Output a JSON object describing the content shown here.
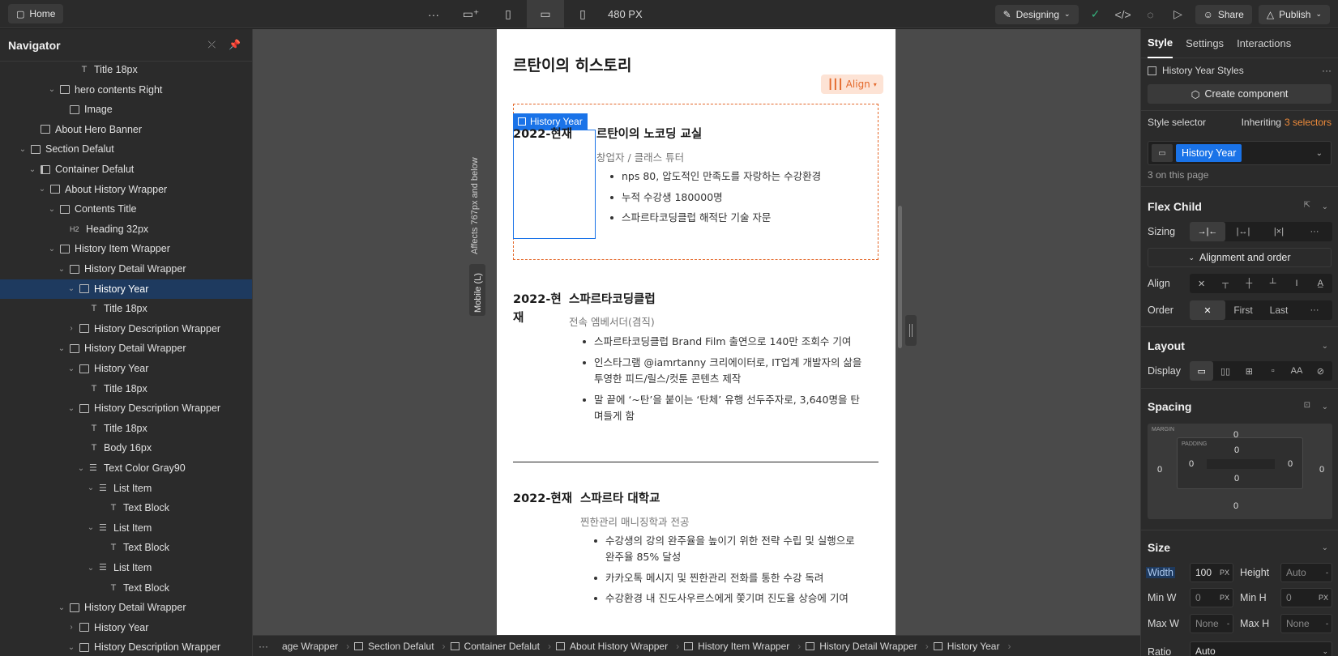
{
  "topbar": {
    "home_label": "Home",
    "width_label": "480 PX",
    "designing_label": "Designing",
    "share_label": "Share",
    "publish_label": "Publish"
  },
  "navigator": {
    "title": "Navigator",
    "items": [
      {
        "label": "Title 18px",
        "icon": "text",
        "depth": 6,
        "chev": ""
      },
      {
        "label": "hero contents Right",
        "icon": "box",
        "depth": 4,
        "chev": "v"
      },
      {
        "label": "Image",
        "icon": "image",
        "depth": 5,
        "chev": ""
      },
      {
        "label": "About Hero Banner",
        "icon": "box",
        "depth": 2,
        "chev": ""
      },
      {
        "label": "Section Defalut",
        "icon": "section",
        "depth": 1,
        "chev": "v"
      },
      {
        "label": "Container Defalut",
        "icon": "container",
        "depth": 2,
        "chev": "v"
      },
      {
        "label": "About History Wrapper",
        "icon": "box",
        "depth": 3,
        "chev": "v"
      },
      {
        "label": "Contents Title",
        "icon": "box",
        "depth": 4,
        "chev": "v"
      },
      {
        "label": "Heading 32px",
        "icon": "h2",
        "depth": 5,
        "chev": ""
      },
      {
        "label": "History Item Wrapper",
        "icon": "box",
        "depth": 4,
        "chev": "v"
      },
      {
        "label": "History Detail Wrapper",
        "icon": "box",
        "depth": 5,
        "chev": "v"
      },
      {
        "label": "History Year",
        "icon": "box",
        "depth": 6,
        "chev": "v",
        "selected": true
      },
      {
        "label": "Title 18px",
        "icon": "text",
        "depth": 7,
        "chev": ""
      },
      {
        "label": "History Description Wrapper",
        "icon": "box",
        "depth": 6,
        "chev": ">"
      },
      {
        "label": "History Detail Wrapper",
        "icon": "box",
        "depth": 5,
        "chev": "v"
      },
      {
        "label": "History Year",
        "icon": "box",
        "depth": 6,
        "chev": "v"
      },
      {
        "label": "Title 18px",
        "icon": "text",
        "depth": 7,
        "chev": ""
      },
      {
        "label": "History Description Wrapper",
        "icon": "box",
        "depth": 6,
        "chev": "v"
      },
      {
        "label": "Title 18px",
        "icon": "text",
        "depth": 7,
        "chev": ""
      },
      {
        "label": "Body 16px",
        "icon": "text",
        "depth": 7,
        "chev": ""
      },
      {
        "label": "Text Color Gray90",
        "icon": "list",
        "depth": 7,
        "chev": "v"
      },
      {
        "label": "List Item",
        "icon": "list",
        "depth": 8,
        "chev": "v"
      },
      {
        "label": "Text Block",
        "icon": "text",
        "depth": 9,
        "chev": ""
      },
      {
        "label": "List Item",
        "icon": "list",
        "depth": 8,
        "chev": "v"
      },
      {
        "label": "Text Block",
        "icon": "text",
        "depth": 9,
        "chev": ""
      },
      {
        "label": "List Item",
        "icon": "list",
        "depth": 8,
        "chev": "v"
      },
      {
        "label": "Text Block",
        "icon": "text",
        "depth": 9,
        "chev": ""
      },
      {
        "label": "History Detail Wrapper",
        "icon": "box",
        "depth": 5,
        "chev": "v"
      },
      {
        "label": "History Year",
        "icon": "box",
        "depth": 6,
        "chev": ">"
      },
      {
        "label": "History Description Wrapper",
        "icon": "box",
        "depth": 6,
        "chev": "v"
      }
    ]
  },
  "canvas": {
    "breakpoint_note": "Affects 767px and below",
    "breakpoint_tab": "Mobile (L)",
    "align_label": "Align",
    "selected_tag": "History Year",
    "heading": "르탄이의 히스토리",
    "entries": [
      {
        "year": "2022-현재",
        "title": "르탄이의 노코딩 교실",
        "role": "창업자 / 클래스 튜터",
        "bullets": [
          "nps 80, 압도적인 만족도를 자랑하는 수강환경",
          "누적 수강생 180000명",
          "스파르타코딩클럽 해적단 기술 자문"
        ]
      },
      {
        "year_line1": "2022-현",
        "year_line2": "재",
        "title": "스파르타코딩클럽",
        "role": "전속 엠베서더(겸직)",
        "bullets": [
          "스파르타코딩클럽 Brand Film 출연으로 140만 조회수 기여",
          "인스타그램 @iamrtanny 크리에이터로, IT업계 개발자의 삶을",
          "투영한 피드/릴스/컷툰 콘텐츠 제작",
          "말 끝에 ‘~탄’을 붙이는 ‘탄체’ 유행 선두주자로, 3,640명을 탄",
          "며들게 함"
        ]
      },
      {
        "year": "2022-현재",
        "title": "스파르타 대학교",
        "role": "찐한관리 매니징학과 전공",
        "bullets": [
          "수강생의 강의 완주율을 높이기 위한 전략 수립 및 실행으로",
          "완주율 85% 달성",
          "카카오톡 메시지 및 찐한관리 전화를 통한 수강 독려",
          "수강환경 내 진도사우르스에게 쫓기며 진도율 상승에 기여"
        ]
      }
    ]
  },
  "breadcrumb": [
    "age Wrapper",
    "Section Defalut",
    "Container Defalut",
    "About History Wrapper",
    "History Item Wrapper",
    "History Detail Wrapper",
    "History Year"
  ],
  "panel": {
    "tabs": [
      "Style",
      "Settings",
      "Interactions"
    ],
    "styles_label": "History Year Styles",
    "create_component": "Create component",
    "style_selector_label": "Style selector",
    "inheriting_label": "Inheriting",
    "inheriting_count": "3 selectors",
    "selector_chip": "History Year",
    "on_page": "3 on this page",
    "flex_child": "Flex Child",
    "sizing_label": "Sizing",
    "alignment_order": "Alignment and order",
    "align_label": "Align",
    "order_label": "Order",
    "order_first": "First",
    "order_last": "Last",
    "layout": "Layout",
    "display_label": "Display",
    "spacing": "Spacing",
    "margin_label": "MARGIN",
    "padding_label": "PADDING",
    "margin": {
      "top": "0",
      "right": "0",
      "bottom": "0",
      "left": "0"
    },
    "padding": {
      "top": "0",
      "right": "0",
      "bottom": "0",
      "left": "0"
    },
    "size": "Size",
    "width_label": "Width",
    "width_value": "100",
    "width_unit": "PX",
    "height_label": "Height",
    "height_value": "Auto",
    "minw_label": "Min W",
    "minw_value": "0",
    "minw_unit": "PX",
    "minh_label": "Min H",
    "minh_value": "0",
    "minh_unit": "PX",
    "maxw_label": "Max W",
    "maxw_value": "None",
    "maxh_label": "Max H",
    "maxh_value": "None",
    "ratio_label": "Ratio",
    "ratio_value": "Auto"
  },
  "colors": {
    "accent_blue": "#1a73e8",
    "align_orange": "#e4682a",
    "selection_bg": "#1e3a5f"
  }
}
